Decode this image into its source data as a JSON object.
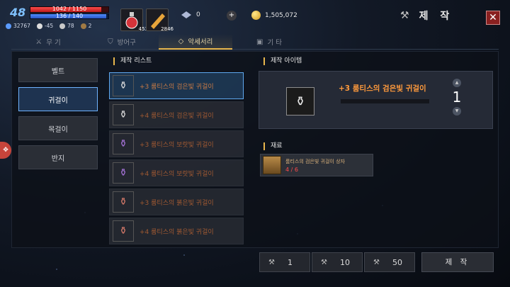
{
  "player": {
    "level": "48",
    "hp": "1042 / 1150",
    "hp_fraction": 0.906,
    "mp": "136 / 140",
    "mp_fraction": 0.971,
    "stats": [
      "32767",
      "-45",
      "78",
      "2"
    ]
  },
  "inventory_shortcuts": {
    "potion_count": "453",
    "scroll_count": "2846"
  },
  "currency": {
    "crystal": "0",
    "gold": "1,505,072"
  },
  "header": {
    "title": "제 작",
    "close_label": "✕"
  },
  "tabs": [
    {
      "label": "무 기",
      "icon": "crossed-swords-icon"
    },
    {
      "label": "방어구",
      "icon": "shield-icon"
    },
    {
      "label": "악세서리",
      "icon": "necklace-icon"
    },
    {
      "label": "기 타",
      "icon": "box-icon"
    }
  ],
  "active_tab": 2,
  "categories": [
    "벨트",
    "귀걸이",
    "목걸이",
    "반지"
  ],
  "active_category": 1,
  "recipe_list": {
    "header": "제작 리스트",
    "items": [
      "+3 룸티스의 검은빛 귀걸이",
      "+4 룸티스의 검은빛 귀걸이",
      "+3 룸티스의 보랏빛 귀걸이",
      "+4 룸티스의 보랏빛 귀걸이",
      "+3 룸티스의 붉은빛 귀걸이",
      "+4 룸티스의 붉은빛 귀걸이"
    ]
  },
  "craft_item": {
    "header": "제작 아이템",
    "name": "+3 룸티스의 검은빛 귀걸이",
    "quantity": "1"
  },
  "materials": {
    "header": "재료",
    "items": [
      {
        "name": "룸티스의 검은빛 귀걸이 상자",
        "count": "4 / 6"
      }
    ]
  },
  "quantity_buttons": [
    "1",
    "10",
    "50"
  ],
  "craft_button": "제 작",
  "colors": {
    "accent_gold": "#e8b64c",
    "selected_blue": "#5ea8ef",
    "item_name_orange": "#ff9a3c",
    "insufficient_red": "#ff4b4b"
  }
}
